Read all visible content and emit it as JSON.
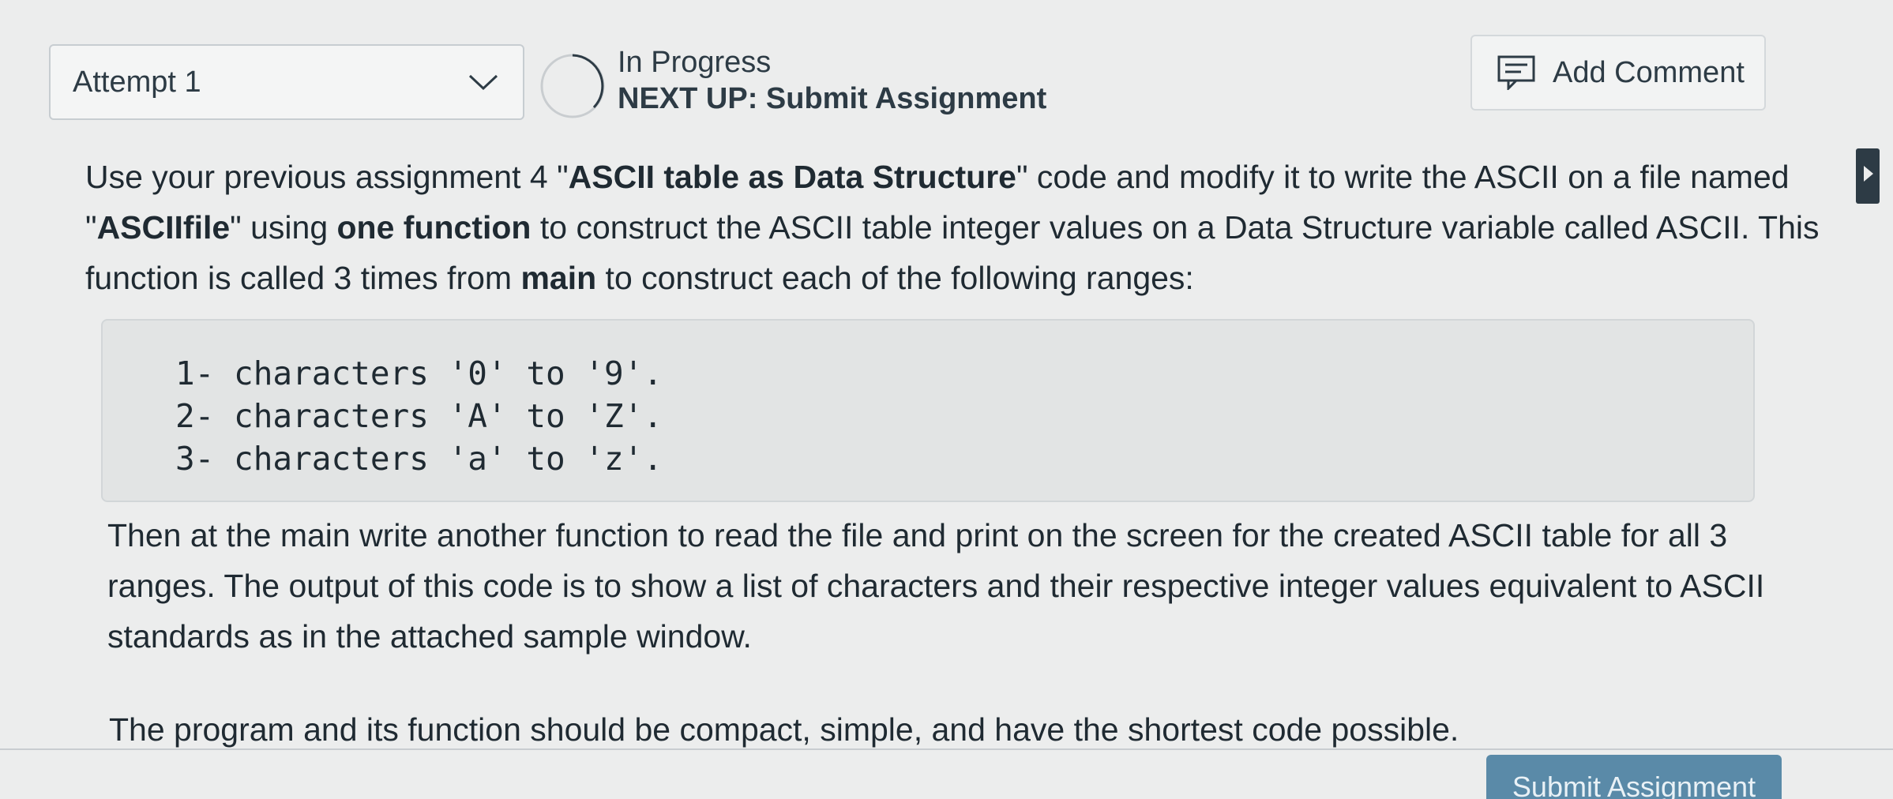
{
  "attempt_select": {
    "value": "Attempt 1"
  },
  "status": {
    "state": "In Progress",
    "next_up": "NEXT UP: Submit Assignment"
  },
  "add_comment": {
    "label": "Add Comment"
  },
  "instructions": {
    "p1_a": "Use your previous assignment 4 \"",
    "p1_b": "ASCII table as Data Structure",
    "p1_c": "\" code and modify it to write the ASCII on a file named \"",
    "p1_d": "ASCIIfile",
    "p1_e": "\" using ",
    "p1_f": "one function",
    "p1_g": " to construct the ASCII table integer values on a Data Structure variable called ASCII. This function is called 3 times from ",
    "p1_h": "main",
    "p1_i": " to construct each of the following ranges:",
    "code_lines": [
      "1- characters '0' to '9'.",
      "2- characters 'A' to 'Z'.",
      "3- characters 'a' to 'z'."
    ],
    "p2": "Then at the main write another function to read the file and print on the screen for the created ASCII table for all 3 ranges. The output of this code is to show a list of characters and their respective integer values equivalent to ASCII standards as in the attached sample window.",
    "p3": "The program and its function should be compact, simple, and have the shortest code possible."
  },
  "submit_button": {
    "label": "Submit Assignment"
  },
  "icons": {
    "dropdown": "chevron-down-icon",
    "status": "progress-ring-icon",
    "comment": "comment-icon"
  },
  "colors": {
    "text": "#1f2a32",
    "code_bg": "#e2e4e4",
    "submit_bg": "#5a8aa8"
  }
}
